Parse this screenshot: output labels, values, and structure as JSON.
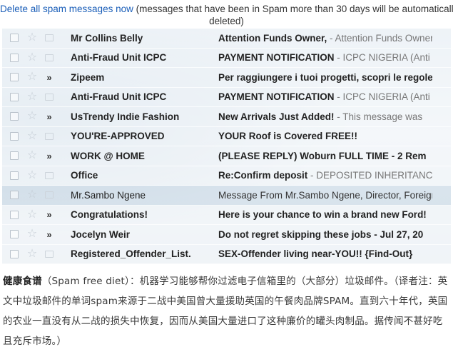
{
  "notice": {
    "link_text": "Delete all spam messages now",
    "text": " (messages that have been in Spam more than 30 days will be automatically",
    "text_line2": "deleted)"
  },
  "messages": [
    {
      "sender": "Mr Collins Belly",
      "subject": "Attention Funds Owner,",
      "snippet": " - Attention Funds Owner",
      "important": false,
      "read": false
    },
    {
      "sender": "Anti-Fraud Unit ICPC",
      "subject": "PAYMENT NOTIFICATION",
      "snippet": " - ICPC NIGERIA (Anti",
      "important": false,
      "read": false
    },
    {
      "sender": "Zipeem",
      "subject": "Per raggiungere i tuoi progetti, scopri le regole",
      "snippet": "",
      "important": true,
      "read": false
    },
    {
      "sender": "Anti-Fraud Unit ICPC",
      "subject": "PAYMENT NOTIFICATION",
      "snippet": " - ICPC NIGERIA (Anti",
      "important": false,
      "read": false
    },
    {
      "sender": "UsTrendy Indie Fashion",
      "subject": "New Arrivals Just Added!",
      "snippet": " - This message was",
      "important": true,
      "read": false
    },
    {
      "sender": "YOU'RE-APPROVED",
      "subject": "YOUR Roof is Covered FREE!!",
      "snippet": "",
      "important": false,
      "read": false
    },
    {
      "sender": "WORK @ HOME",
      "subject": "(PLEASE REPLY) Woburn FULL TIME - 2 Rem",
      "snippet": "",
      "important": true,
      "read": false
    },
    {
      "sender": "Office",
      "subject": "Re:Confirm deposit",
      "snippet": " - DEPOSITED INHERITANCE",
      "important": false,
      "read": false
    },
    {
      "sender": "Mr.Sambo Ngene",
      "subject": "Message From Mr.Sambo Ngene, Director, Foreign",
      "snippet": "",
      "important": false,
      "read": true
    },
    {
      "sender": "Congratulations!",
      "subject": "Here is your chance to win a brand new Ford!",
      "snippet": "",
      "important": true,
      "read": false
    },
    {
      "sender": "Jocelyn Weir",
      "subject": "Do not regret skipping these jobs - Jul 27, 20",
      "snippet": "",
      "important": true,
      "read": false
    },
    {
      "sender": "Registered_Offender_List.",
      "subject": "SEX-Offender living near-YOU!! {Find-Out}",
      "snippet": "",
      "important": false,
      "read": false
    }
  ],
  "caption": {
    "title": "健康食谱",
    "body": "（Spam free diet）：机器学习能够帮你过滤电子信箱里的（大部分）垃圾邮件。（译者注：英文中垃圾邮件的单词spam来源于二战中美国曾大量援助英国的午餐肉品牌SPAM。直到六十年代，英国的农业一直没有从二战的损失中恢复，因而从美国大量进口了这种廉价的罐头肉制品。据传闻不甚好吃且充斥市场。）"
  }
}
